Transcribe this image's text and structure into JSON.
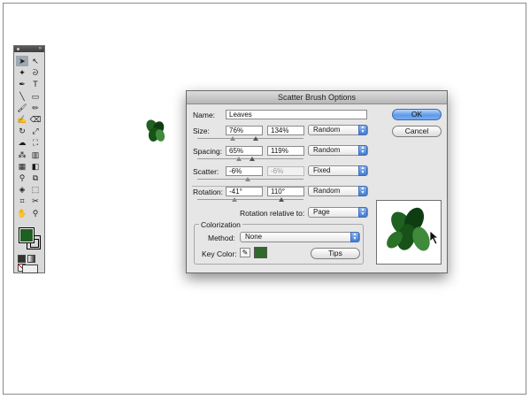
{
  "colors": {
    "fill": "#1f5f22",
    "key_color": "#2f6a2a",
    "leaf_dark": "#0f3d12",
    "leaf_mid": "#1f6121",
    "leaf_light": "#3f8a3b"
  },
  "tools": {
    "icons": [
      "selection-icon",
      "direct-selection-icon",
      "magic-wand-icon",
      "lasso-icon",
      "pen-icon",
      "type-icon",
      "line-icon",
      "rectangle-icon",
      "paintbrush-icon",
      "pencil-icon",
      "blob-brush-icon",
      "eraser-icon",
      "rotate-icon",
      "scale-icon",
      "warp-icon",
      "free-transform-icon",
      "symbol-sprayer-icon",
      "graph-icon",
      "mesh-icon",
      "gradient-icon",
      "eyedropper-icon",
      "blend-icon",
      "live-paint-icon",
      "live-paint-selection-icon",
      "crop-icon",
      "slice-icon",
      "hand-icon",
      "zoom-icon"
    ]
  },
  "dialog": {
    "title": "Scatter Brush Options",
    "name_label": "Name:",
    "name_value": "Leaves",
    "rows": [
      {
        "label": "Size:",
        "min": "76%",
        "max": "134%",
        "method": "Random",
        "max_disabled": false
      },
      {
        "label": "Spacing:",
        "min": "65%",
        "max": "119%",
        "method": "Random",
        "max_disabled": false
      },
      {
        "label": "Scatter:",
        "min": "-6%",
        "max": "-6%",
        "method": "Fixed",
        "max_disabled": true
      },
      {
        "label": "Rotation:",
        "min": "-41°",
        "max": "110°",
        "method": "Random",
        "max_disabled": false
      }
    ],
    "rotation_relative_label": "Rotation relative to:",
    "rotation_relative_value": "Page",
    "colorization": {
      "title": "Colorization",
      "method_label": "Method:",
      "method_value": "None",
      "key_color_label": "Key Color:",
      "tips_label": "Tips"
    },
    "ok_label": "OK",
    "cancel_label": "Cancel"
  }
}
